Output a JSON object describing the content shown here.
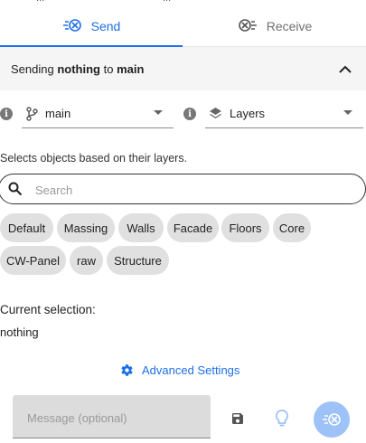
{
  "top_strip": {
    "left_text": "...",
    "right_text": "..."
  },
  "tabs": [
    {
      "label": "Send",
      "icon": "send-icon",
      "active": true
    },
    {
      "label": "Receive",
      "icon": "receive-icon",
      "active": false
    }
  ],
  "header": {
    "prefix": "Sending ",
    "object": "nothing",
    "middle": " to ",
    "branch": "main"
  },
  "branch_select": {
    "value": "main",
    "icon": "branch-icon"
  },
  "filter_select": {
    "value": "Layers",
    "icon": "layers-icon"
  },
  "description": "Selects objects based on their layers.",
  "search": {
    "placeholder": "Search",
    "value": ""
  },
  "layers": [
    "Default",
    "Massing",
    "Walls",
    "Facade",
    "Floors",
    "Core",
    "CW-Panel",
    "raw",
    "Structure"
  ],
  "selection": {
    "label": "Current selection:",
    "value": "nothing"
  },
  "advanced_settings": {
    "label": "Advanced Settings",
    "icon": "gear-icon"
  },
  "message": {
    "placeholder": "Message (optional)",
    "value": ""
  },
  "colors": {
    "accent": "#1e6fe8",
    "fab": "#9cc2f7",
    "chip": "#e0e0e0",
    "header_bg": "#f5f5f5"
  }
}
